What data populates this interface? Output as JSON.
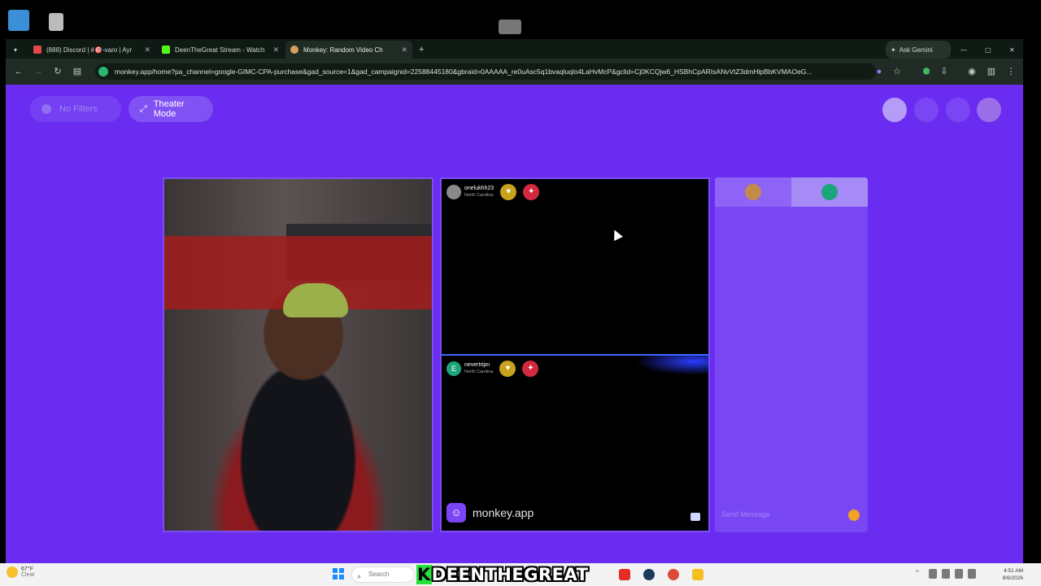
{
  "browser": {
    "tabs": [
      {
        "label": "(888) Discord | #🎯-varo | Ayr",
        "color": "#e04a4a",
        "active": false
      },
      {
        "label": "DeenTheGreat Stream - Watch",
        "color": "#53fc18",
        "active": false
      },
      {
        "label": "Monkey: Random Video Ch",
        "color": "#d9a05b",
        "active": true
      }
    ],
    "new_tab": "+",
    "ask_gemini": "Ask Gemini",
    "url": "monkey.app/home?pa_channel=google-GIMC-CPA-purchase&gad_source=1&gad_campaignid=22588445180&gbraid=0AAAAA_re0uAsc5q1bvaqluqlo4LaHvMcP&gclid=Cj0KCQjw6_HSBhCpARIsANvVtZ3dmHlpBbKVMAOeG..."
  },
  "page": {
    "no_filters_label": "No Filters",
    "theater_mode_label": "Theater Mode",
    "peers": [
      {
        "name": "onelukhh23",
        "location": "North Carolina",
        "avatar_letter": ""
      },
      {
        "name": "nevertripn",
        "location": "North Carolina",
        "avatar_letter": "E"
      }
    ],
    "brand": "monkey.app",
    "chat": {
      "placeholder": "Send Message"
    }
  },
  "overlay": {
    "k": "K",
    "text": "DEENTHEGREAT"
  },
  "taskbar": {
    "weather_temp": "67°F",
    "weather_desc": "Clear",
    "search_placeholder": "Search",
    "time": "4:51 AM",
    "date": "8/6/2026"
  },
  "colors": {
    "page_bg": "#6a2cf0",
    "panel_border": "#7d4df3",
    "badge_yellow": "#c7a21a",
    "badge_red": "#d22a3f"
  }
}
